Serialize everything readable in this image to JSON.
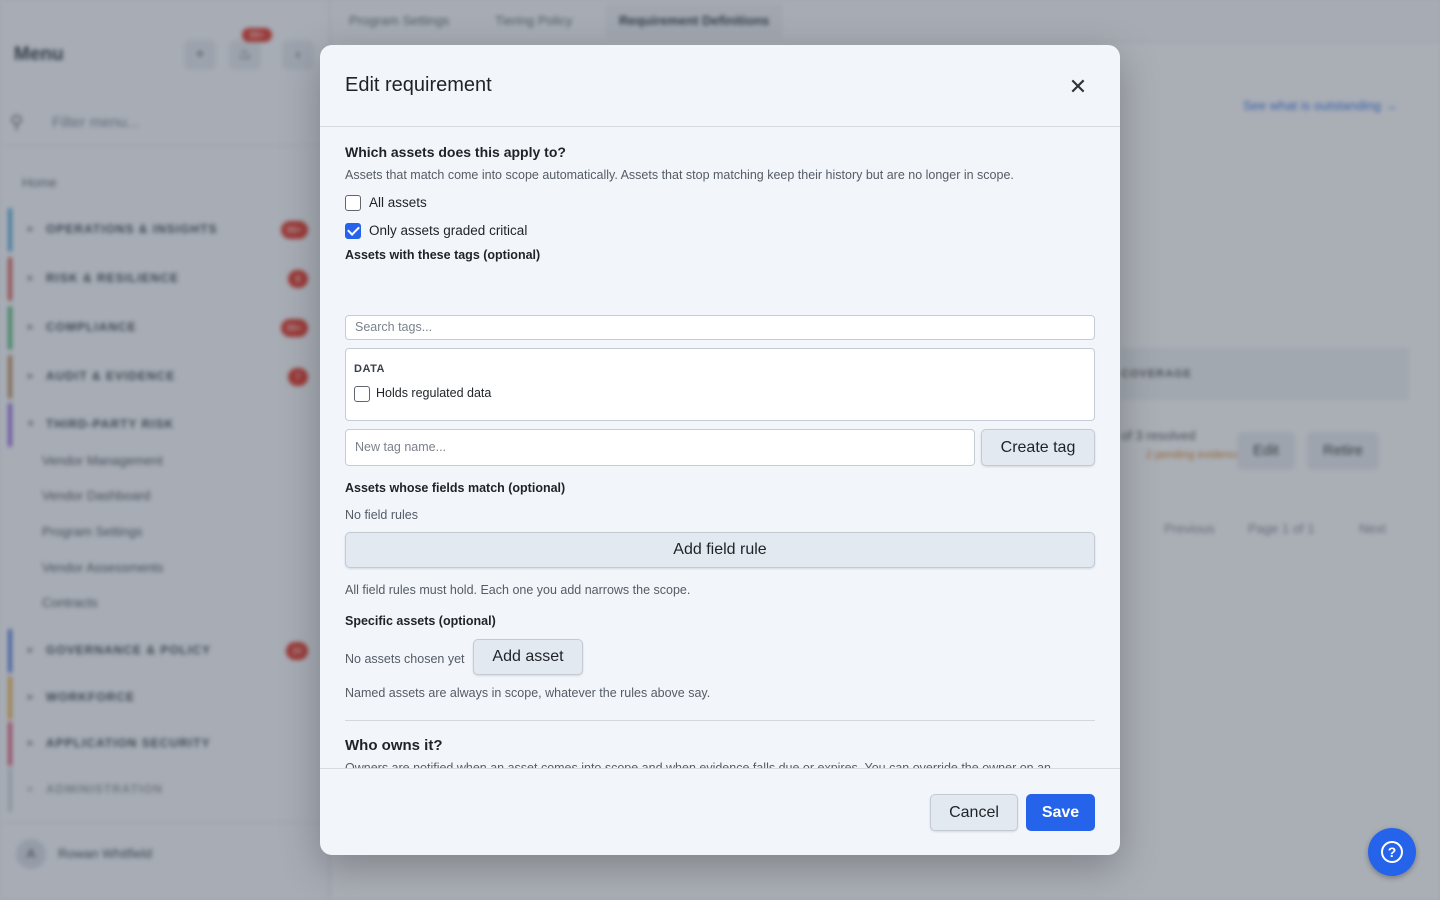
{
  "sidebar": {
    "title": "Menu",
    "add_icon": "plus-icon",
    "bell_icon": "bell-icon",
    "collapse_icon": "chevron-left-icon",
    "notification_badge": "99+",
    "filter_placeholder": "Filter menu...",
    "home_label": "Home",
    "sections": [
      {
        "label": "OPERATIONS & INSIGHTS",
        "count": "99+",
        "color": "#4a9fd4"
      },
      {
        "label": "RISK & RESILIENCE",
        "count": "8",
        "color": "#d14a4a"
      },
      {
        "label": "COMPLIANCE",
        "count": "99+",
        "color": "#3ea86a"
      },
      {
        "label": "AUDIT & EVIDENCE",
        "count": "7",
        "color": "#b07a4a"
      },
      {
        "label": "THIRD-PARTY RISK",
        "count": "",
        "color": "#8a5ad6"
      },
      {
        "label": "GOVERNANCE & POLICY",
        "count": "20",
        "color": "#4a6fd4"
      },
      {
        "label": "WORKFORCE",
        "count": "",
        "color": "#e0a23a"
      },
      {
        "label": "APPLICATION SECURITY",
        "count": "",
        "color": "#d14a6a"
      },
      {
        "label": "ADMINISTRATION",
        "count": "",
        "color": "#9aa1ab"
      }
    ],
    "third_party_items": [
      "Vendor Management",
      "Vendor Dashboard",
      "Program Settings",
      "Vendor Assessments",
      "Contracts"
    ],
    "user_initial": "A",
    "user_name": "Rowan Whitfield"
  },
  "main": {
    "tabs": [
      "Program Settings",
      "Tiering Policy",
      "Requirement Definitions"
    ],
    "outstanding_link": "See what is outstanding →",
    "coverage_label": "COVERAGE",
    "resolved_text": "of 3 resolved",
    "pending_text": "2 pending evidence",
    "edit_label": "Edit",
    "retire_label": "Retire",
    "previous_label": "Previous",
    "page_label": "Page 1 of 1",
    "next_label": "Next"
  },
  "modal": {
    "title": "Edit requirement",
    "close_icon": "close-icon",
    "scope": {
      "heading": "Which assets does this apply to?",
      "description": "Assets that match come into scope automatically. Assets that stop matching keep their history but are no longer in scope.",
      "all_assets_label": "All assets",
      "all_assets_checked": false,
      "critical_label": "Only assets graded critical",
      "critical_checked": true
    },
    "tags": {
      "heading": "Assets with these tags (optional)",
      "search_placeholder": "Search tags...",
      "group_name": "DATA",
      "tag_option": "Holds regulated data",
      "tag_option_checked": false,
      "new_tag_placeholder": "New tag name...",
      "create_tag_label": "Create tag"
    },
    "fields": {
      "heading": "Assets whose fields match (optional)",
      "empty_text": "No field rules",
      "add_rule_label": "Add field rule",
      "note": "All field rules must hold. Each one you add narrows the scope."
    },
    "specific": {
      "heading": "Specific assets (optional)",
      "empty_text": "No assets chosen yet",
      "add_asset_label": "Add asset",
      "note": "Named assets are always in scope, whatever the rules above say."
    },
    "owner": {
      "heading": "Who owns it?",
      "description": "Owners are notified when an asset comes into scope and when evidence falls due or expires. You can override the owner on an individual asset later."
    },
    "cancel_label": "Cancel",
    "save_label": "Save"
  },
  "help_icon": "question-mark-icon",
  "colors": {
    "primary": "#2563eb",
    "modal_bg": "#f2f6fb",
    "danger_badge": "#d92d20"
  }
}
